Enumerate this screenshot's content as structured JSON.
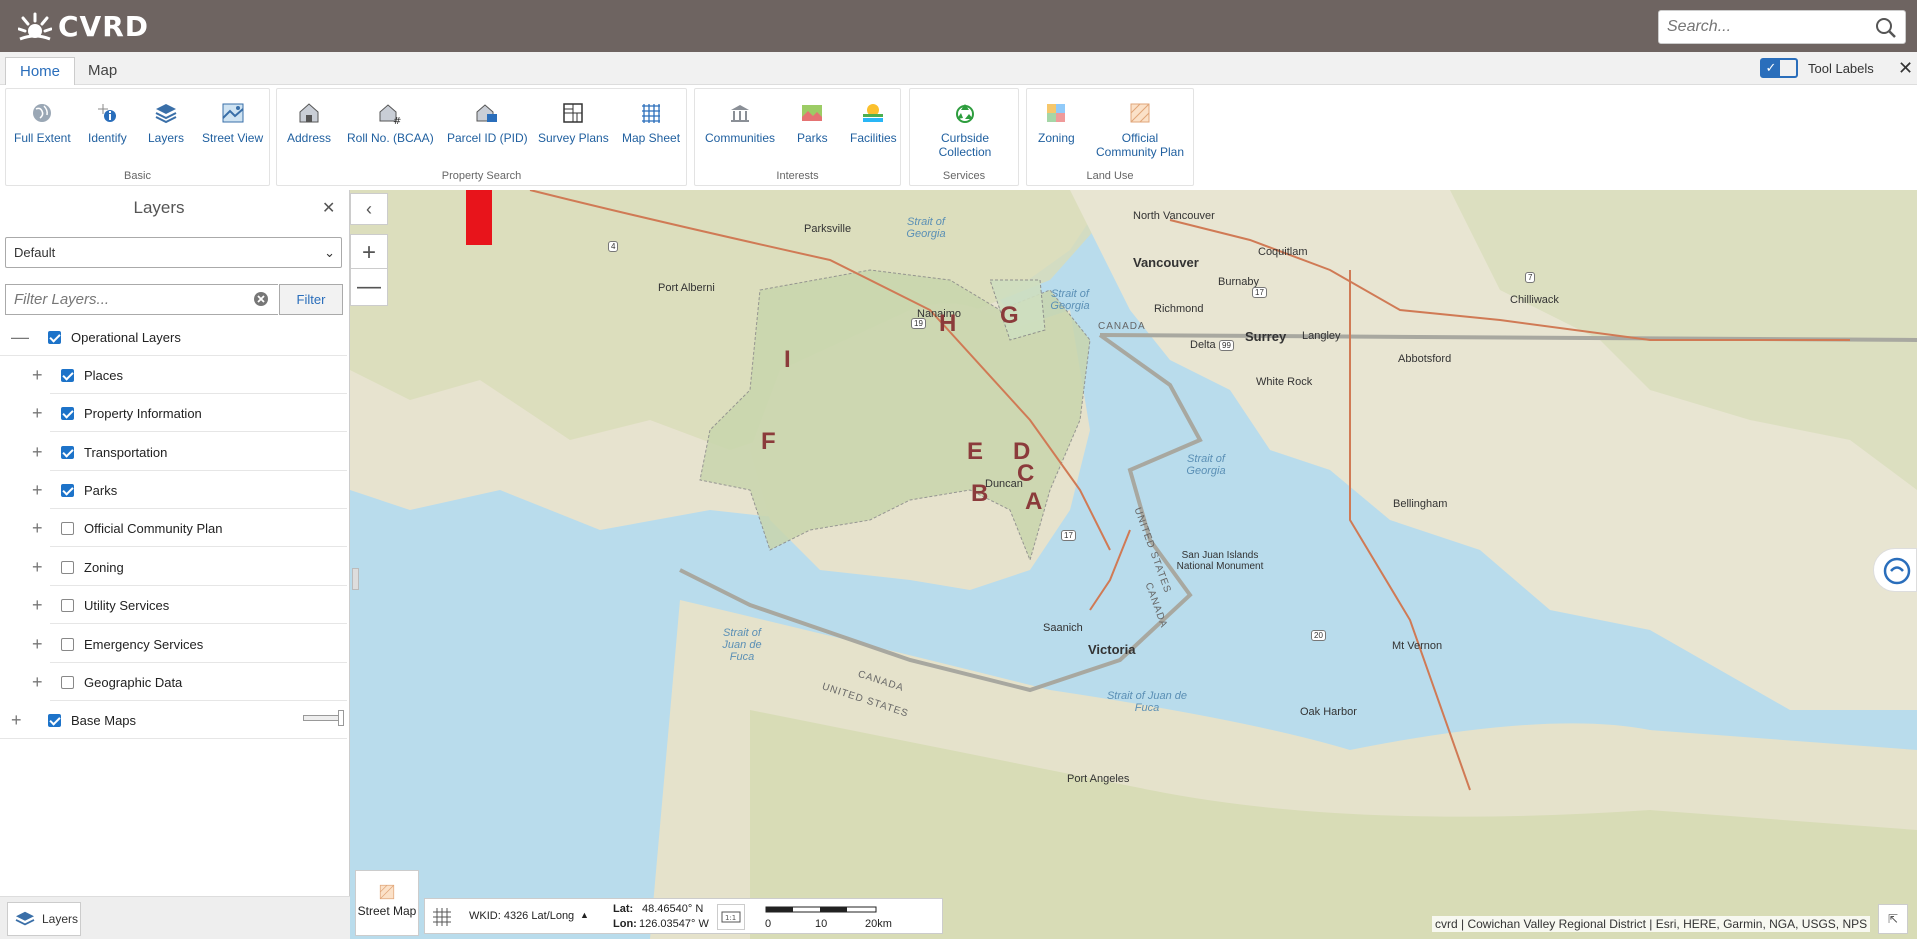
{
  "app": {
    "logo_text": "CVRD"
  },
  "search": {
    "placeholder": "Search..."
  },
  "tabs": [
    {
      "label": "Home"
    },
    {
      "label": "Map"
    }
  ],
  "tool_labels": {
    "label": "Tool Labels"
  },
  "ribbon": {
    "basic": {
      "label": "Basic",
      "tools": [
        "Full Extent",
        "Identify",
        "Layers",
        "Street View"
      ]
    },
    "property_search": {
      "label": "Property Search",
      "tools": [
        "Address",
        "Roll No. (BCAA)",
        "Parcel ID (PID)",
        "Survey Plans",
        "Map Sheet"
      ]
    },
    "interests": {
      "label": "Interests",
      "tools": [
        "Communities",
        "Parks",
        "Facilities"
      ]
    },
    "services": {
      "label": "Services",
      "tools": [
        "Curbside Collection"
      ]
    },
    "land_use": {
      "label": "Land Use",
      "tools": [
        "Zoning",
        "Official Community Plan"
      ]
    }
  },
  "layers_panel": {
    "title": "Layers",
    "preset": "Default",
    "filter_placeholder": "Filter Layers...",
    "filter_button": "Filter",
    "operational": {
      "label": "Operational Layers",
      "checked": true
    },
    "items": [
      {
        "label": "Places",
        "checked": true
      },
      {
        "label": "Property Information",
        "checked": true
      },
      {
        "label": "Transportation",
        "checked": true
      },
      {
        "label": "Parks",
        "checked": true
      },
      {
        "label": "Official Community Plan",
        "checked": false
      },
      {
        "label": "Zoning",
        "checked": false
      },
      {
        "label": "Utility Services",
        "checked": false
      },
      {
        "label": "Emergency Services",
        "checked": false
      },
      {
        "label": "Geographic Data",
        "checked": false
      }
    ],
    "base_maps": {
      "label": "Base Maps",
      "checked": true
    },
    "bottom_tab": "Layers"
  },
  "map": {
    "places": [
      "Parksville",
      "Port Alberni",
      "Nanaimo",
      "North Vancouver",
      "Vancouver",
      "Coquitlam",
      "Burnaby",
      "Richmond",
      "Surrey",
      "Langley",
      "Delta",
      "Chilliwack",
      "Abbotsford",
      "White Rock",
      "Duncan",
      "Bellingham",
      "San Juan Islands National Monument",
      "Saanich",
      "Victoria",
      "Mt Vernon",
      "Oak Harbor",
      "Port Angeles"
    ],
    "water": [
      "Strait of Georgia",
      "Strait of Georgia",
      "Strait of Georgia",
      "Strait of Juan de Fuca",
      "Strait of Juan de Fuca"
    ],
    "borders": [
      "CANADA",
      "CANADA",
      "UNITED STATES",
      "CANADA",
      "UNITED STATES"
    ],
    "areas": [
      "G",
      "H",
      "I",
      "F",
      "E",
      "D",
      "C",
      "B",
      "A"
    ],
    "shields": [
      "4",
      "19",
      "17",
      "99",
      "17",
      "7",
      "17",
      "20"
    ]
  },
  "footer": {
    "basemap_label": "Street Map",
    "wkid": "WKID: 4326 Lat/Long",
    "lat_label": "Lat:",
    "lat_value": "48.46540° N",
    "lon_label": "Lon:",
    "lon_value": "126.03547° W",
    "scale_ticks": [
      "0",
      "10",
      "20km"
    ],
    "attribution": "cvrd | Cowichan Valley Regional District | Esri, HERE, Garmin, NGA, USGS, NPS"
  },
  "colors": {
    "topbar": "#6e6461",
    "accent": "#2a6ebb",
    "arrow": "#e8141b"
  }
}
